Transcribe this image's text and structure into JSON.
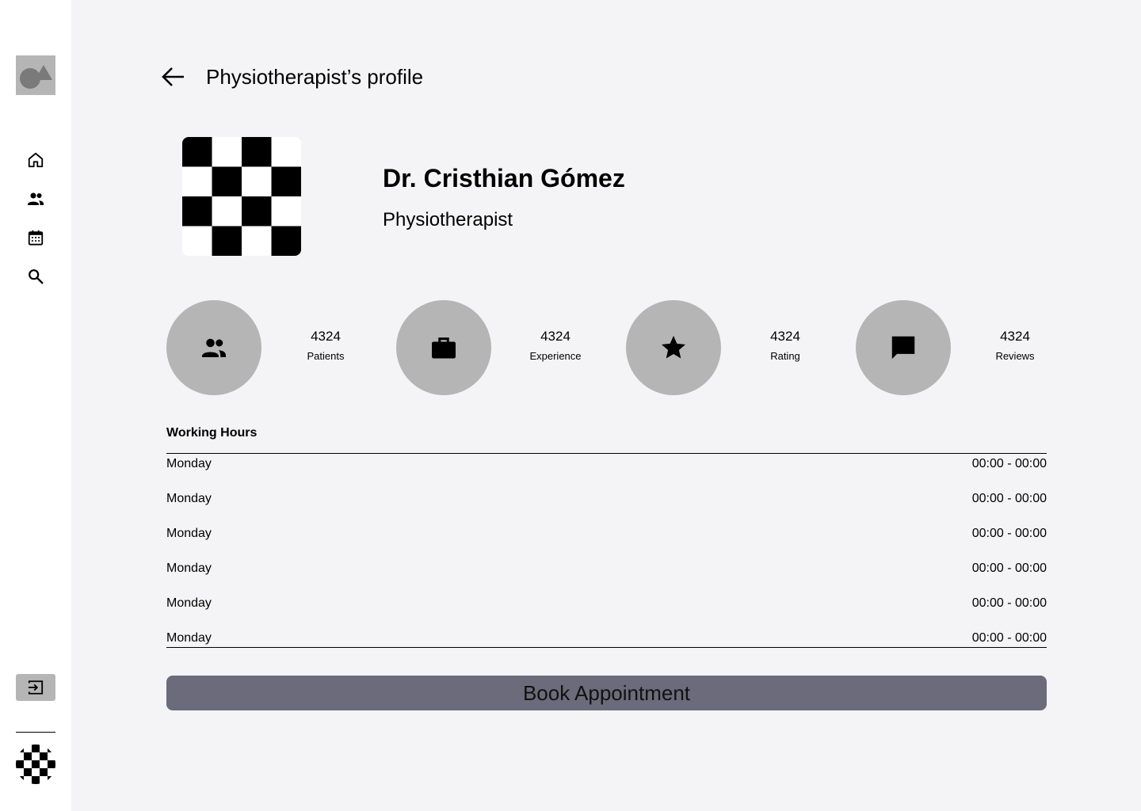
{
  "header": {
    "title": "Physiotherapist’s profile"
  },
  "sidebar": {
    "logo_icon": "shapes-logo-icon",
    "items": [
      {
        "icon": "home-icon"
      },
      {
        "icon": "people-icon"
      },
      {
        "icon": "calendar-icon"
      },
      {
        "icon": "search-icon"
      }
    ],
    "logout_icon": "logout-icon"
  },
  "profile": {
    "name": "Dr. Cristhian Gómez",
    "role": "Physiotherapist"
  },
  "stats": [
    {
      "value": "4324",
      "label": "Patients",
      "icon": "people-icon"
    },
    {
      "value": "4324",
      "label": "Experience",
      "icon": "briefcase-icon"
    },
    {
      "value": "4324",
      "label": "Rating",
      "icon": "star-icon"
    },
    {
      "value": "4324",
      "label": "Reviews",
      "icon": "chat-icon"
    }
  ],
  "working_hours": {
    "title": "Working Hours",
    "rows": [
      {
        "day": "Monday",
        "hours": "00:00 - 00:00"
      },
      {
        "day": "Monday",
        "hours": "00:00 - 00:00"
      },
      {
        "day": "Monday",
        "hours": "00:00 - 00:00"
      },
      {
        "day": "Monday",
        "hours": "00:00 - 00:00"
      },
      {
        "day": "Monday",
        "hours": "00:00 - 00:00"
      },
      {
        "day": "Monday",
        "hours": "00:00 - 00:00"
      }
    ]
  },
  "actions": {
    "book_label": "Book Appointment"
  },
  "colors": {
    "background": "#f4f4f6",
    "sidebar": "#ffffff",
    "placeholder_gray": "#b5b5b5",
    "button": "#6b6b7b"
  }
}
